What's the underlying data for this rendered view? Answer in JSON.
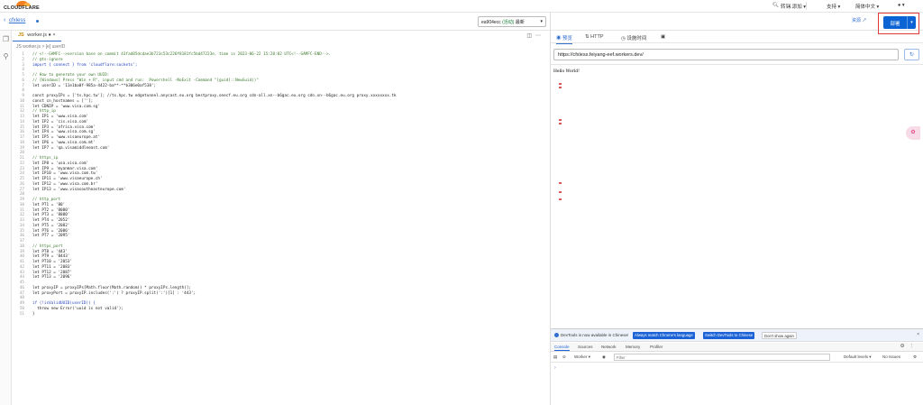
{
  "topbar": {
    "logo_text": "CLOUDFLARE",
    "goto": "转到...",
    "add": "+ 添加",
    "support": "支持",
    "language": "简体中文"
  },
  "crumb": {
    "worker_name": "cfxless",
    "version_id": "ea904ecc",
    "version_tag": "(活动)",
    "version_latest": "最新"
  },
  "editor": {
    "file_tab": "worker.js",
    "file_lang": "JS",
    "breadcrumb": "JS worker.js > [e] userID",
    "lines": [
      {
        "n": 1,
        "t": "// <!--GAMFC-->version base on commit 43fad05dcdae3b723c53c226f8181fc5bd47223e, time is 2023-06-22 15:20:02 UTC<!--GAMFC-END-->.",
        "c": "cm"
      },
      {
        "n": 2,
        "t": "// @ts-ignore",
        "c": "cm"
      },
      {
        "n": 3,
        "t": "import { connect } from 'cloudflare:sockets';",
        "c": "kw"
      },
      {
        "n": 4,
        "t": "",
        "c": "tx"
      },
      {
        "n": 5,
        "t": "// How to generate your own UUID:",
        "c": "cm"
      },
      {
        "n": 6,
        "t": "// [Windows] Press \"Win + R\", input cmd and run:  Powershell -NoExit -Command \"[guid]::NewGuid()\"",
        "c": "cm"
      },
      {
        "n": 7,
        "t": "let userID = '11e1ba0f-985a-4422-ba**-**b306e0af538';",
        "c": "tx"
      },
      {
        "n": 8,
        "t": "",
        "c": "tx"
      },
      {
        "n": 9,
        "t": "const proxyIPs = ['ts.hpc.tw']; //ts.hpc.tw edgetunnel.anycast.eu.org bestproxy.onecf.eu.org cdn-all.xn--b6gac.eu.org cdn.xn--b6gac.eu.org proxy.xxxxxxxx.tk",
        "c": "tx"
      },
      {
        "n": 10,
        "t": "const cn_hostnames = [''];",
        "c": "tx"
      },
      {
        "n": 11,
        "t": "let CDNIP = 'www.visa.com.sg'",
        "c": "tx"
      },
      {
        "n": 12,
        "t": "// http_ip",
        "c": "cm"
      },
      {
        "n": 13,
        "t": "let IP1 = 'www.visa.com'",
        "c": "tx"
      },
      {
        "n": 14,
        "t": "let IP2 = 'cis.visa.com'",
        "c": "tx"
      },
      {
        "n": 15,
        "t": "let IP3 = 'africa.visa.com'",
        "c": "tx"
      },
      {
        "n": 16,
        "t": "let IP4 = 'www.visa.com.sg'",
        "c": "tx"
      },
      {
        "n": 17,
        "t": "let IP5 = 'www.visaeurope.at'",
        "c": "tx"
      },
      {
        "n": 18,
        "t": "let IP6 = 'www.visa.com.mt'",
        "c": "tx"
      },
      {
        "n": 19,
        "t": "let IP7 = 'qa.visamiddleeast.com'",
        "c": "tx"
      },
      {
        "n": 20,
        "t": "",
        "c": "tx"
      },
      {
        "n": 21,
        "t": "// https_ip",
        "c": "cm"
      },
      {
        "n": 22,
        "t": "let IP8 = 'usa.visa.com'",
        "c": "tx"
      },
      {
        "n": 23,
        "t": "let IP9 = 'myanmar.visa.com'",
        "c": "tx"
      },
      {
        "n": 24,
        "t": "let IP10 = 'www.visa.com.tw'",
        "c": "tx"
      },
      {
        "n": 25,
        "t": "let IP11 = 'www.visaeurope.ch'",
        "c": "tx"
      },
      {
        "n": 26,
        "t": "let IP12 = 'www.visa.com.br'",
        "c": "tx"
      },
      {
        "n": 27,
        "t": "let IP13 = 'www.visasoutheasteurope.com'",
        "c": "tx"
      },
      {
        "n": 28,
        "t": "",
        "c": "tx"
      },
      {
        "n": 29,
        "t": "// http_port",
        "c": "cm"
      },
      {
        "n": 30,
        "t": "let PT1 = '80'",
        "c": "tx"
      },
      {
        "n": 31,
        "t": "let PT2 = '8080'",
        "c": "tx"
      },
      {
        "n": 32,
        "t": "let PT3 = '8880'",
        "c": "tx"
      },
      {
        "n": 33,
        "t": "let PT4 = '2052'",
        "c": "tx"
      },
      {
        "n": 34,
        "t": "let PT5 = '2082'",
        "c": "tx"
      },
      {
        "n": 35,
        "t": "let PT6 = '2086'",
        "c": "tx"
      },
      {
        "n": 36,
        "t": "let PT7 = '2095'",
        "c": "tx"
      },
      {
        "n": 37,
        "t": "",
        "c": "tx"
      },
      {
        "n": 38,
        "t": "// https_port",
        "c": "cm"
      },
      {
        "n": 39,
        "t": "let PT8 = '443'",
        "c": "tx"
      },
      {
        "n": 40,
        "t": "let PT9 = '8443'",
        "c": "tx"
      },
      {
        "n": 41,
        "t": "let PT10 = '2053'",
        "c": "tx"
      },
      {
        "n": 42,
        "t": "let PT11 = '2083'",
        "c": "tx"
      },
      {
        "n": 43,
        "t": "let PT12 = '2087'",
        "c": "tx"
      },
      {
        "n": 44,
        "t": "let PT13 = '2096'",
        "c": "tx"
      },
      {
        "n": 45,
        "t": "",
        "c": "tx"
      },
      {
        "n": 46,
        "t": "let proxyIP = proxyIPs[Math.floor(Math.random() * proxyIPs.length)];",
        "c": "tx"
      },
      {
        "n": 47,
        "t": "let proxyPort = proxyIP.includes(':') ? proxyIP.split(':')[1] : '443';",
        "c": "tx"
      },
      {
        "n": 48,
        "t": "",
        "c": "tx"
      },
      {
        "n": 49,
        "t": "if (!isValidUUID(userID)) {",
        "c": "kw"
      },
      {
        "n": 50,
        "t": "  throw new Error('uuid is not valid');",
        "c": "tx"
      },
      {
        "n": 51,
        "t": "}",
        "c": "tx"
      }
    ]
  },
  "right": {
    "resource_link": "资源",
    "deploy_label": "部署",
    "tabs": [
      "预览",
      "HTTP",
      "设施时间"
    ],
    "url": "https://cfxless.feiyang-eef.workers.dev/",
    "preview_text": "Hello World!"
  },
  "devtools": {
    "notice_text": "DevTools is now available in Chinese!",
    "btn_always": "Always match Chrome's language",
    "btn_switch": "Switch DevTools to Chinese",
    "btn_dont": "Don't show again",
    "tabs": [
      "Console",
      "Sources",
      "Network",
      "Memory",
      "Profiler"
    ],
    "context": "Worker",
    "filter_placeholder": "Filter",
    "levels": "Default levels",
    "issues": "No Issues"
  }
}
